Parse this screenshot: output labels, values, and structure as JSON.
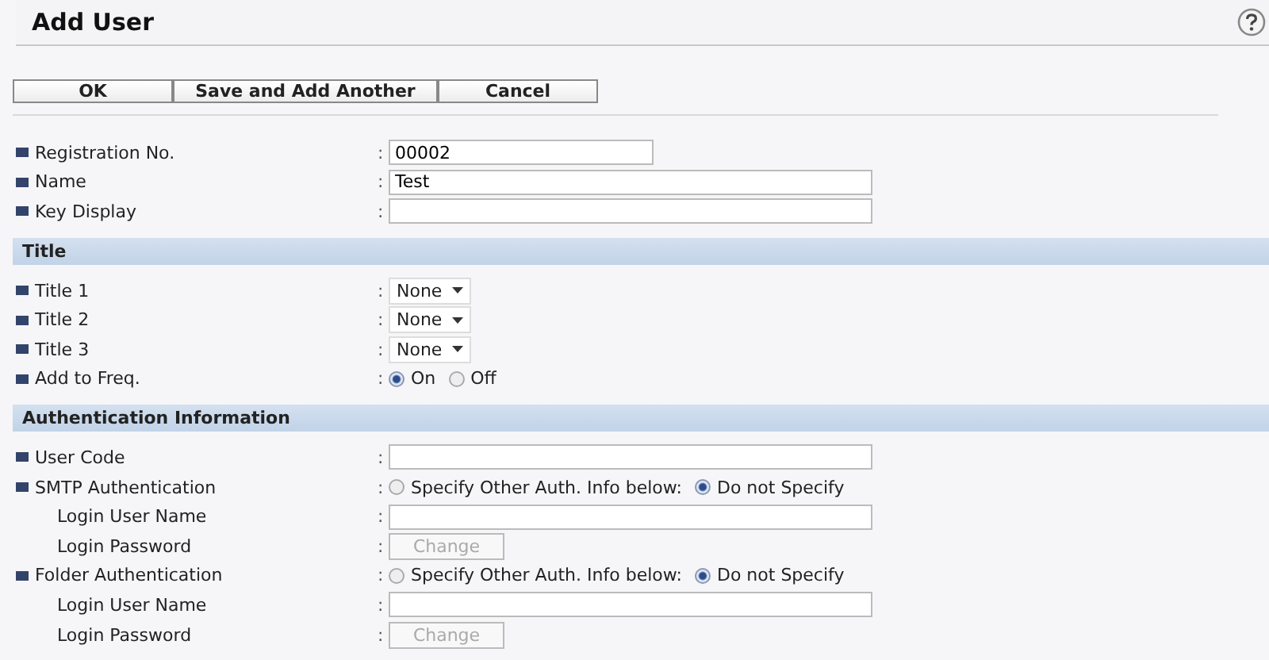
{
  "title": "Add User",
  "buttons": [
    {
      "label": "OK"
    },
    {
      "label": "Save and Add Another"
    },
    {
      "label": "Cancel"
    }
  ],
  "sections": [
    {
      "rows": [
        {
          "kind": "number",
          "label": "Registration No.",
          "sep": ":",
          "sub": false,
          "value": "00002"
        },
        {
          "kind": "text",
          "label": "Name",
          "sep": ":",
          "sub": false,
          "value": "Test"
        },
        {
          "kind": "text",
          "label": "Key Display",
          "sep": ":",
          "sub": false,
          "value": ""
        }
      ]
    },
    {
      "heading": "Title",
      "rows": [
        {
          "kind": "select",
          "label": "Title 1",
          "sep": ":",
          "sub": false,
          "value": "None"
        },
        {
          "kind": "select",
          "label": "Title 2",
          "sep": ":",
          "sub": false,
          "value": "None"
        },
        {
          "kind": "select",
          "label": "Title 3",
          "sep": ":",
          "sub": false,
          "value": "None"
        },
        {
          "kind": "radio",
          "label": "Add to Freq.",
          "sep": ":",
          "sub": false,
          "options": [
            {
              "label": "On",
              "selected": true
            },
            {
              "label": "Off",
              "selected": false
            }
          ]
        }
      ]
    },
    {
      "heading": "Authentication Information",
      "rows": [
        {
          "kind": "text",
          "label": "User Code",
          "sep": ":",
          "sub": false,
          "value": ""
        },
        {
          "kind": "radio",
          "label": "SMTP Authentication",
          "sep": ":",
          "sub": false,
          "options": [
            {
              "label": "Specify Other Auth. Info below:",
              "selected": false
            },
            {
              "label": "Do not Specify",
              "selected": true
            }
          ]
        },
        {
          "kind": "text",
          "label": "Login User Name",
          "sep": ":",
          "sub": true,
          "value": ""
        },
        {
          "kind": "button",
          "label": "Login Password",
          "sep": ":",
          "sub": true,
          "button": "Change",
          "disabled": true
        },
        {
          "kind": "radio",
          "label": "Folder Authentication",
          "sep": ":",
          "sub": false,
          "options": [
            {
              "label": "Specify Other Auth. Info below:",
              "selected": false
            },
            {
              "label": "Do not Specify",
              "selected": true
            }
          ]
        },
        {
          "kind": "text",
          "label": "Login User Name",
          "sep": ":",
          "sub": true,
          "value": ""
        },
        {
          "kind": "button",
          "label": "Login Password",
          "sep": ":",
          "sub": true,
          "button": "Change",
          "disabled": true
        }
      ]
    }
  ]
}
